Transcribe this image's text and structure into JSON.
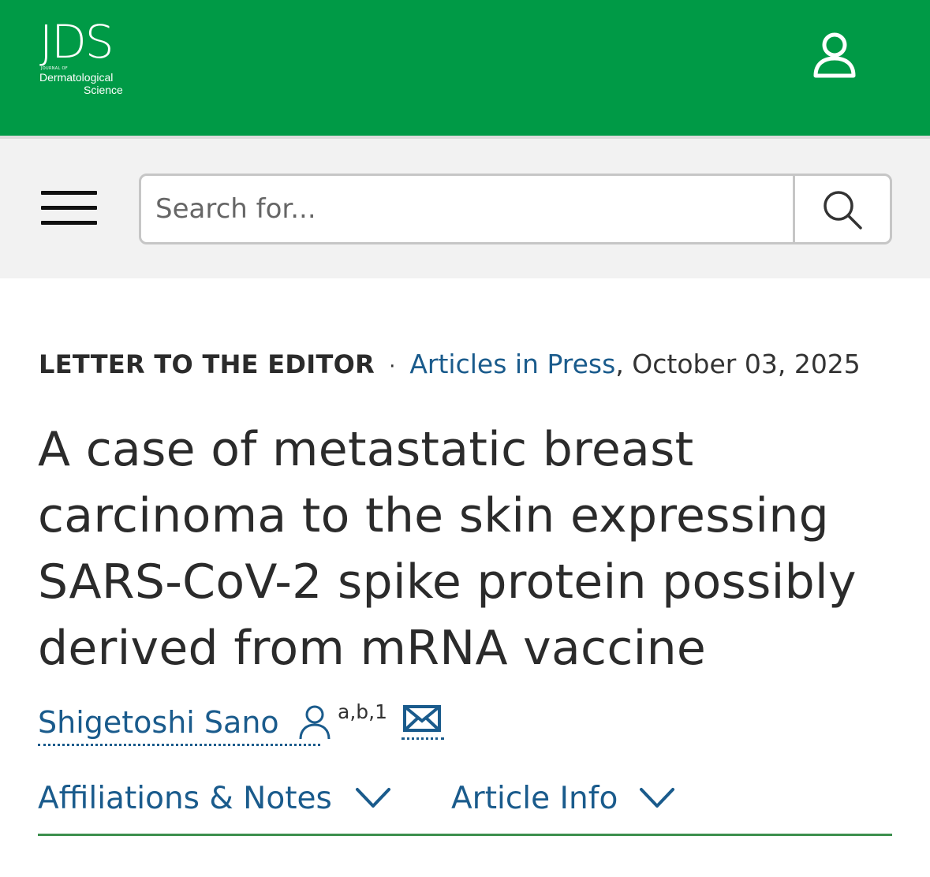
{
  "header": {
    "logo": {
      "main": "JDS",
      "journal_of": "JOURNAL OF",
      "line1": "Dermatological",
      "line2": "Science"
    },
    "user_icon": "user-account-icon",
    "background_color": "#009a46"
  },
  "toolbar": {
    "menu_icon": "hamburger-menu-icon",
    "search": {
      "placeholder": "Search for...",
      "value": "",
      "icon": "search-icon"
    }
  },
  "article": {
    "type": "LETTER TO THE EDITOR",
    "separator": "·",
    "section_link": "Articles in Press",
    "date": ", October 03, 2025",
    "title": "A case of metastatic breast carcinoma to the skin expressing SARS-CoV-2 spike protein possibly derived from mRNA vaccine",
    "author": {
      "name": "Shigetoshi Sano",
      "affiliations": "a,b,1",
      "person_icon": "person-icon",
      "mail_icon": "mail-icon"
    },
    "tabs": [
      {
        "label": "Affiliations & Notes",
        "icon": "chevron-down-icon"
      },
      {
        "label": "Article Info",
        "icon": "chevron-down-icon"
      }
    ]
  },
  "colors": {
    "brand_green": "#009a46",
    "link_blue": "#1a5b8c",
    "divider_green": "#3c8f4d"
  }
}
